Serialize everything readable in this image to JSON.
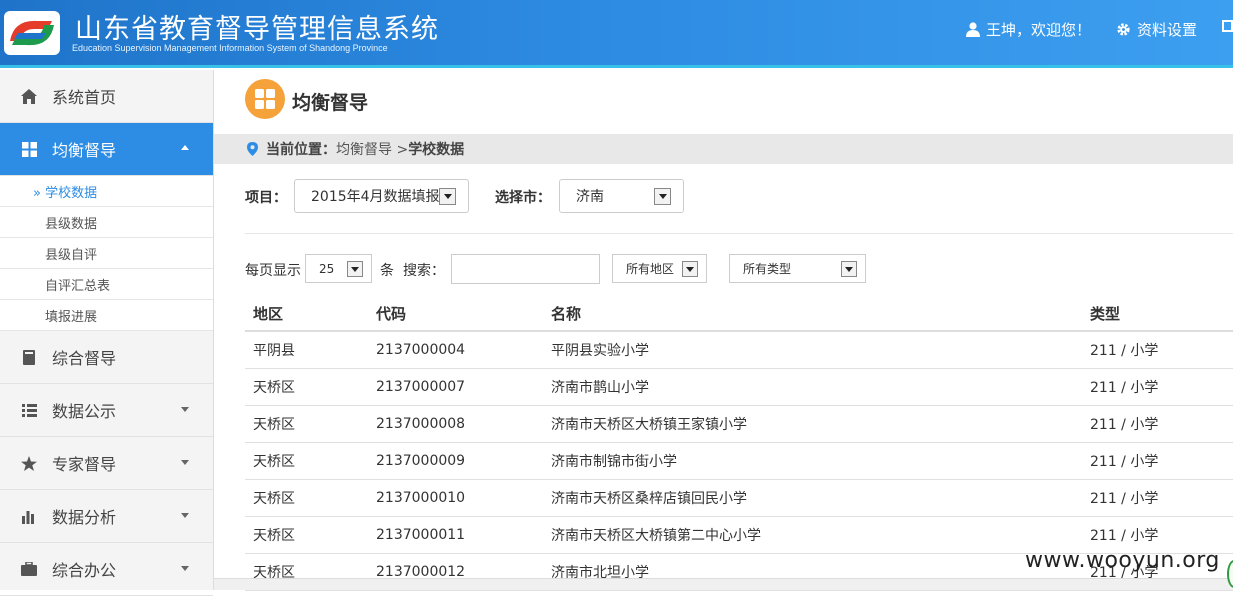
{
  "header": {
    "title_zh": "山东省教育督导管理信息系统",
    "title_en": "Education Supervision Management Information System of Shandong Province",
    "user_greeting": "王坤，欢迎您！",
    "settings_label": "资料设置",
    "accent_color": "#2d8ce3"
  },
  "sidebar": {
    "items": [
      {
        "label": "系统首页",
        "icon": "home-icon"
      },
      {
        "label": "均衡督导",
        "icon": "grid-icon",
        "expanded": true
      },
      {
        "label": "综合督导",
        "icon": "book-icon"
      },
      {
        "label": "数据公示",
        "icon": "list-icon"
      },
      {
        "label": "专家督导",
        "icon": "star-icon"
      },
      {
        "label": "数据分析",
        "icon": "bar-chart-icon"
      },
      {
        "label": "综合办公",
        "icon": "briefcase-icon"
      }
    ],
    "sub_items": [
      "» 学校数据",
      "县级数据",
      "县级自评",
      "自评汇总表",
      "填报进展"
    ]
  },
  "page": {
    "title": "均衡督导",
    "breadcrumb_prefix": "当前位置：",
    "breadcrumb_path": "均衡督导 > ",
    "breadcrumb_current": "学校数据"
  },
  "filters": {
    "project_label": "项目：",
    "project_value": "2015年4月数据填报",
    "city_label": "选择市：",
    "city_value": "济南",
    "per_page_label": "每页显示",
    "per_page_value": "25",
    "per_page_unit": "条",
    "search_label": "搜索：",
    "region_value": "所有地区",
    "type_value": "所有类型"
  },
  "table": {
    "headers": [
      "地区",
      "代码",
      "名称",
      "类型"
    ],
    "rows": [
      [
        "平阴县",
        "2137000004",
        "平阴县实验小学",
        "211 / 小学"
      ],
      [
        "天桥区",
        "2137000007",
        "济南市鹊山小学",
        "211 / 小学"
      ],
      [
        "天桥区",
        "2137000008",
        "济南市天桥区大桥镇王家镇小学",
        "211 / 小学"
      ],
      [
        "天桥区",
        "2137000009",
        "济南市制锦市街小学",
        "211 / 小学"
      ],
      [
        "天桥区",
        "2137000010",
        "济南市天桥区桑梓店镇回民小学",
        "211 / 小学"
      ],
      [
        "天桥区",
        "2137000011",
        "济南市天桥区大桥镇第二中心小学",
        "211 / 小学"
      ],
      [
        "天桥区",
        "2137000012",
        "济南市北坦小学",
        "211 / 小学"
      ]
    ]
  },
  "watermark": "www.wooyun.org"
}
